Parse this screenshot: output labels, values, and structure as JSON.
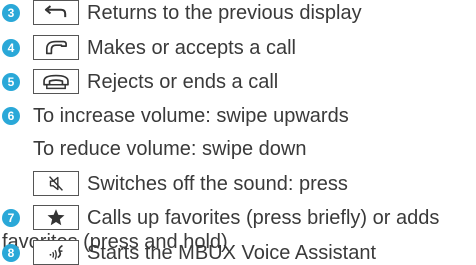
{
  "items": [
    {
      "number": "3",
      "icon": "back-arrow-icon",
      "text": "Returns to the previous display"
    },
    {
      "number": "4",
      "icon": "phone-accept-icon",
      "text": "Makes or accepts a call"
    },
    {
      "number": "5",
      "icon": "phone-reject-icon",
      "text": "Rejects or ends a call"
    },
    {
      "number": "6",
      "text": "To increase volume: swipe upwards",
      "text2": "To reduce volume: swipe down",
      "sub_icon": "mute-speaker-icon",
      "sub_text": "Switches off the sound: press"
    },
    {
      "number": "7",
      "icon": "star-favorites-icon",
      "text": "Calls up favorites (press briefly) or adds",
      "text2": "favorites (press and hold)"
    },
    {
      "number": "8",
      "icon": "voice-assistant-icon",
      "text": "Starts the MBUX Voice Assistant"
    }
  ],
  "colors": {
    "accent": "#2aa8d8",
    "text": "#3a3a3a",
    "icon": "#333333"
  }
}
